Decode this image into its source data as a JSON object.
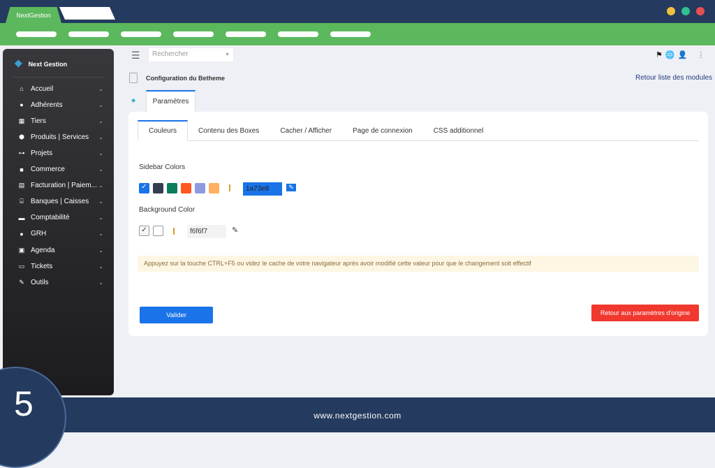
{
  "browser": {
    "tab_label": "NextGestion",
    "window_dots": [
      "#f0c040",
      "#30c090",
      "#e85050"
    ]
  },
  "sidebar": {
    "brand": "Next Gestion",
    "items": [
      {
        "label": "Accueil",
        "icon": "home-icon"
      },
      {
        "label": "Adhérents",
        "icon": "user-icon"
      },
      {
        "label": "Tiers",
        "icon": "building-icon"
      },
      {
        "label": "Produits | Services",
        "icon": "box-icon"
      },
      {
        "label": "Projets",
        "icon": "sitemap-icon"
      },
      {
        "label": "Commerce",
        "icon": "briefcase-icon"
      },
      {
        "label": "Facturation | Paiem...",
        "icon": "file-invoice-icon"
      },
      {
        "label": "Banques | Caisses",
        "icon": "bank-icon"
      },
      {
        "label": "Comptabilité",
        "icon": "ledger-icon"
      },
      {
        "label": "GRH",
        "icon": "user-icon"
      },
      {
        "label": "Agenda",
        "icon": "calendar-icon"
      },
      {
        "label": "Tickets",
        "icon": "ticket-icon"
      },
      {
        "label": "Outils",
        "icon": "wrench-icon"
      }
    ]
  },
  "header": {
    "search_placeholder": "Rechercher",
    "page_title": "Configuration du Betheme",
    "back_link": "Retour liste des modules",
    "subtab": "Paramètres"
  },
  "tabs": [
    "Couleurs",
    "Contenu des Boxes",
    "Cacher / Afficher",
    "Page de connexion",
    "CSS additionnel"
  ],
  "sidebar_colors": {
    "label": "Sidebar Colors",
    "swatches": [
      "#1a73e8",
      "#363c52",
      "#0a7e5a",
      "#ff5722",
      "#8e9be0",
      "#ffb060"
    ],
    "value": "1a73e8"
  },
  "background_color": {
    "label": "Background Color",
    "swatches": [
      "#f6f6f7",
      "#ffffff"
    ],
    "value": "f6f6f7"
  },
  "notice": "Appuyez sur la touche CTRL+F5 ou videz le cache de votre navigateur après avoir modifié cette valeur pour que le changement soit effectif",
  "buttons": {
    "submit": "Valider",
    "reset": "Retour aux paramètres d'origine"
  },
  "footer": {
    "url": "www.nextgestion.com",
    "step": "5"
  }
}
